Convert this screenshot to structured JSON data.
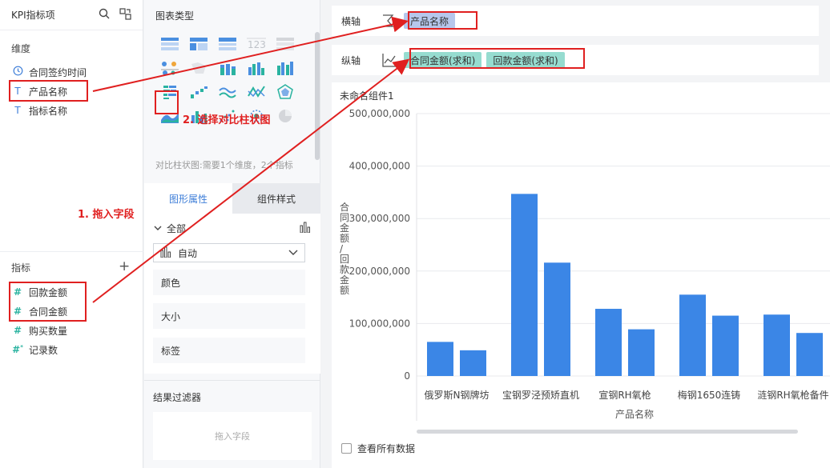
{
  "left": {
    "title": "KPI指标项",
    "dimensions_title": "维度",
    "dimensions": [
      {
        "icon": "clock-icon",
        "label": "合同签约时间"
      },
      {
        "icon": "text-type-icon",
        "label": "产品名称"
      },
      {
        "icon": "text-type-icon",
        "label": "指标名称"
      }
    ],
    "measures_title": "指标",
    "measures": [
      {
        "icon": "number-type-icon",
        "label": "回款金额"
      },
      {
        "icon": "number-type-icon",
        "label": "合同金额"
      },
      {
        "icon": "number-type-icon",
        "label": "购买数量"
      },
      {
        "icon": "calc-number-icon",
        "label": "记录数"
      }
    ]
  },
  "middle": {
    "chart_types_title": "图表类型",
    "description": "对比柱状图:需要1个维度，2个指标",
    "tabs": [
      "图形属性",
      "组件样式"
    ],
    "all_label": "全部",
    "select_value": "自动",
    "props": [
      "颜色",
      "大小",
      "标签"
    ],
    "filter_title": "结果过滤器",
    "filter_placeholder": "拖入字段"
  },
  "axes": {
    "x_label": "横轴",
    "x_pills": [
      "产品名称"
    ],
    "y_label": "纵轴",
    "y_pills": [
      "合同金额(求和)",
      "回款金额(求和)"
    ]
  },
  "annotations": {
    "step1": "1. 拖入字段",
    "step2": "2. 选择对比柱状图"
  },
  "chart": {
    "widget_title": "未命名组件1",
    "check_label": "查看所有数据"
  },
  "chart_data": {
    "type": "bar",
    "xlabel": "产品名称",
    "ylabel": "合同金额/回款金额",
    "ylim": [
      0,
      500000000
    ],
    "yticks": [
      "0",
      "100,000,000",
      "200,000,000",
      "300,000,000",
      "400,000,000",
      "500,000,000"
    ],
    "categories": [
      "俄罗斯N钢牌坊",
      "宝钢罗泾预矫直机",
      "宣钢RH氧枪",
      "梅钢1650连铸",
      "涟钢RH氧枪备件"
    ],
    "series": [
      {
        "values": [
          65000000,
          347000000,
          128000000,
          155000000,
          117000000
        ]
      },
      {
        "values": [
          49000000,
          216000000,
          89000000,
          115000000,
          82000000
        ]
      }
    ],
    "bar_color": "#3b86e6",
    "grid": true
  }
}
